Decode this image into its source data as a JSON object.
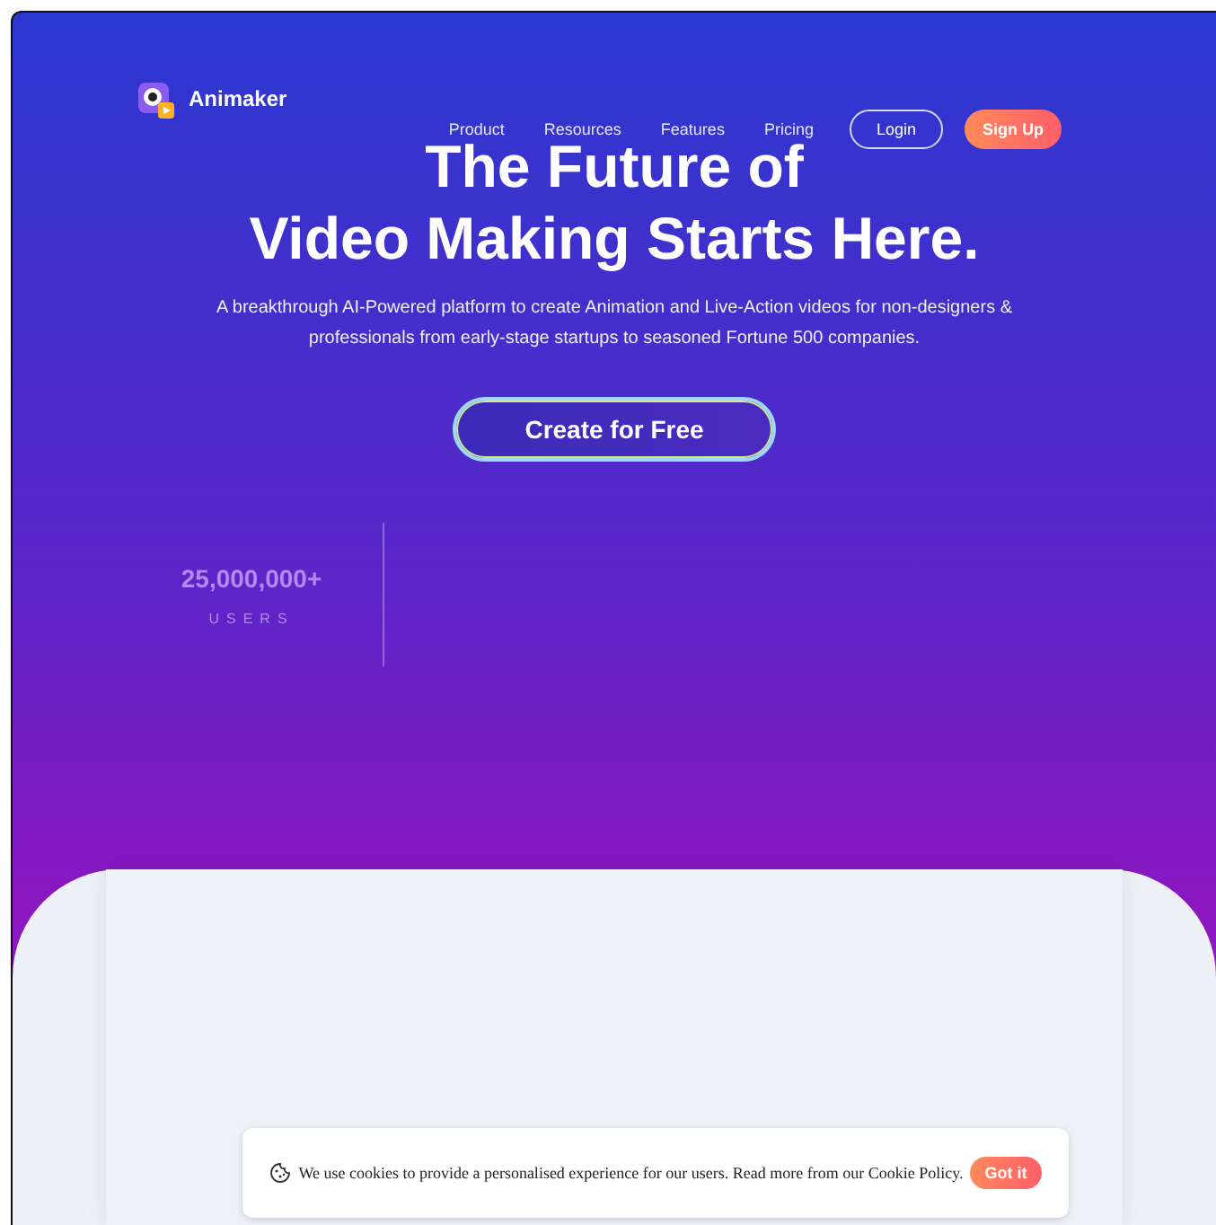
{
  "brand": {
    "name": "Animaker"
  },
  "nav": {
    "links": [
      {
        "label": "Product"
      },
      {
        "label": "Resources"
      },
      {
        "label": "Features"
      },
      {
        "label": "Pricing"
      }
    ],
    "login": "Login",
    "signup": "Sign Up"
  },
  "hero": {
    "title_line_1": "The Future of",
    "title_line_2": "Video Making Starts Here.",
    "subtitle": "A breakthrough AI-Powered platform to create Animation and Live-Action videos for non-designers & professionals from early-stage startups to seasoned Fortune 500 companies.",
    "cta": "Create for Free"
  },
  "stats": [
    {
      "value": "25,000,000+",
      "label": "USERS"
    }
  ],
  "cookie_banner": {
    "text": "We use cookies to provide a personalised experience for our users. Read more from our Cookie Policy.",
    "button": "Got it"
  }
}
